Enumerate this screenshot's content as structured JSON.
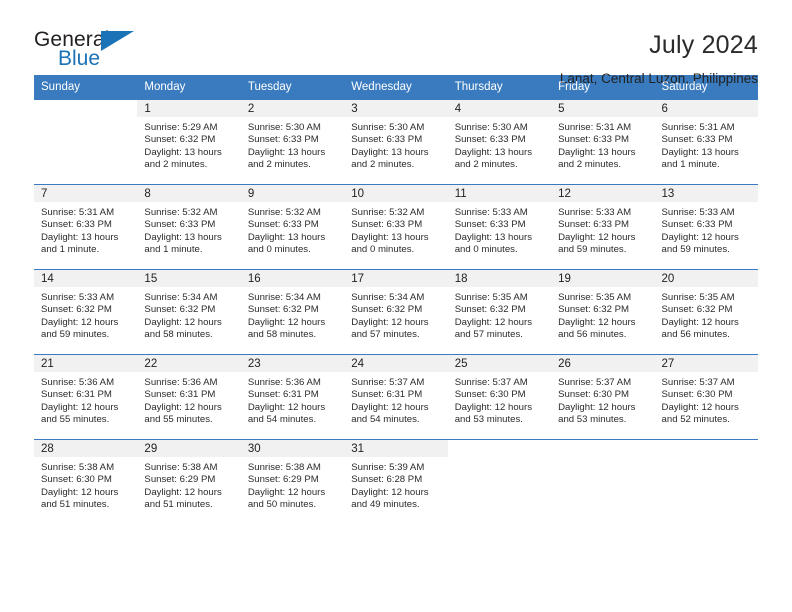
{
  "brand": {
    "word_one": "General",
    "word_two": "Blue",
    "triangle_icon": "blue-triangle-icon",
    "accent_color": "#1a73b7"
  },
  "header": {
    "month_title": "July 2024",
    "location": "Lanat, Central Luzon, Philippines"
  },
  "calendar": {
    "header_color": "#3a7bbf",
    "weekdays": [
      "Sunday",
      "Monday",
      "Tuesday",
      "Wednesday",
      "Thursday",
      "Friday",
      "Saturday"
    ],
    "weeks": [
      [
        {
          "day": "",
          "blank": true
        },
        {
          "day": "1",
          "sunrise": "Sunrise: 5:29 AM",
          "sunset": "Sunset: 6:32 PM",
          "daylight_1": "Daylight: 13 hours",
          "daylight_2": "and 2 minutes."
        },
        {
          "day": "2",
          "sunrise": "Sunrise: 5:30 AM",
          "sunset": "Sunset: 6:33 PM",
          "daylight_1": "Daylight: 13 hours",
          "daylight_2": "and 2 minutes."
        },
        {
          "day": "3",
          "sunrise": "Sunrise: 5:30 AM",
          "sunset": "Sunset: 6:33 PM",
          "daylight_1": "Daylight: 13 hours",
          "daylight_2": "and 2 minutes."
        },
        {
          "day": "4",
          "sunrise": "Sunrise: 5:30 AM",
          "sunset": "Sunset: 6:33 PM",
          "daylight_1": "Daylight: 13 hours",
          "daylight_2": "and 2 minutes."
        },
        {
          "day": "5",
          "sunrise": "Sunrise: 5:31 AM",
          "sunset": "Sunset: 6:33 PM",
          "daylight_1": "Daylight: 13 hours",
          "daylight_2": "and 2 minutes."
        },
        {
          "day": "6",
          "sunrise": "Sunrise: 5:31 AM",
          "sunset": "Sunset: 6:33 PM",
          "daylight_1": "Daylight: 13 hours",
          "daylight_2": "and 1 minute."
        }
      ],
      [
        {
          "day": "7",
          "sunrise": "Sunrise: 5:31 AM",
          "sunset": "Sunset: 6:33 PM",
          "daylight_1": "Daylight: 13 hours",
          "daylight_2": "and 1 minute."
        },
        {
          "day": "8",
          "sunrise": "Sunrise: 5:32 AM",
          "sunset": "Sunset: 6:33 PM",
          "daylight_1": "Daylight: 13 hours",
          "daylight_2": "and 1 minute."
        },
        {
          "day": "9",
          "sunrise": "Sunrise: 5:32 AM",
          "sunset": "Sunset: 6:33 PM",
          "daylight_1": "Daylight: 13 hours",
          "daylight_2": "and 0 minutes."
        },
        {
          "day": "10",
          "sunrise": "Sunrise: 5:32 AM",
          "sunset": "Sunset: 6:33 PM",
          "daylight_1": "Daylight: 13 hours",
          "daylight_2": "and 0 minutes."
        },
        {
          "day": "11",
          "sunrise": "Sunrise: 5:33 AM",
          "sunset": "Sunset: 6:33 PM",
          "daylight_1": "Daylight: 13 hours",
          "daylight_2": "and 0 minutes."
        },
        {
          "day": "12",
          "sunrise": "Sunrise: 5:33 AM",
          "sunset": "Sunset: 6:33 PM",
          "daylight_1": "Daylight: 12 hours",
          "daylight_2": "and 59 minutes."
        },
        {
          "day": "13",
          "sunrise": "Sunrise: 5:33 AM",
          "sunset": "Sunset: 6:33 PM",
          "daylight_1": "Daylight: 12 hours",
          "daylight_2": "and 59 minutes."
        }
      ],
      [
        {
          "day": "14",
          "sunrise": "Sunrise: 5:33 AM",
          "sunset": "Sunset: 6:32 PM",
          "daylight_1": "Daylight: 12 hours",
          "daylight_2": "and 59 minutes."
        },
        {
          "day": "15",
          "sunrise": "Sunrise: 5:34 AM",
          "sunset": "Sunset: 6:32 PM",
          "daylight_1": "Daylight: 12 hours",
          "daylight_2": "and 58 minutes."
        },
        {
          "day": "16",
          "sunrise": "Sunrise: 5:34 AM",
          "sunset": "Sunset: 6:32 PM",
          "daylight_1": "Daylight: 12 hours",
          "daylight_2": "and 58 minutes."
        },
        {
          "day": "17",
          "sunrise": "Sunrise: 5:34 AM",
          "sunset": "Sunset: 6:32 PM",
          "daylight_1": "Daylight: 12 hours",
          "daylight_2": "and 57 minutes."
        },
        {
          "day": "18",
          "sunrise": "Sunrise: 5:35 AM",
          "sunset": "Sunset: 6:32 PM",
          "daylight_1": "Daylight: 12 hours",
          "daylight_2": "and 57 minutes."
        },
        {
          "day": "19",
          "sunrise": "Sunrise: 5:35 AM",
          "sunset": "Sunset: 6:32 PM",
          "daylight_1": "Daylight: 12 hours",
          "daylight_2": "and 56 minutes."
        },
        {
          "day": "20",
          "sunrise": "Sunrise: 5:35 AM",
          "sunset": "Sunset: 6:32 PM",
          "daylight_1": "Daylight: 12 hours",
          "daylight_2": "and 56 minutes."
        }
      ],
      [
        {
          "day": "21",
          "sunrise": "Sunrise: 5:36 AM",
          "sunset": "Sunset: 6:31 PM",
          "daylight_1": "Daylight: 12 hours",
          "daylight_2": "and 55 minutes."
        },
        {
          "day": "22",
          "sunrise": "Sunrise: 5:36 AM",
          "sunset": "Sunset: 6:31 PM",
          "daylight_1": "Daylight: 12 hours",
          "daylight_2": "and 55 minutes."
        },
        {
          "day": "23",
          "sunrise": "Sunrise: 5:36 AM",
          "sunset": "Sunset: 6:31 PM",
          "daylight_1": "Daylight: 12 hours",
          "daylight_2": "and 54 minutes."
        },
        {
          "day": "24",
          "sunrise": "Sunrise: 5:37 AM",
          "sunset": "Sunset: 6:31 PM",
          "daylight_1": "Daylight: 12 hours",
          "daylight_2": "and 54 minutes."
        },
        {
          "day": "25",
          "sunrise": "Sunrise: 5:37 AM",
          "sunset": "Sunset: 6:30 PM",
          "daylight_1": "Daylight: 12 hours",
          "daylight_2": "and 53 minutes."
        },
        {
          "day": "26",
          "sunrise": "Sunrise: 5:37 AM",
          "sunset": "Sunset: 6:30 PM",
          "daylight_1": "Daylight: 12 hours",
          "daylight_2": "and 53 minutes."
        },
        {
          "day": "27",
          "sunrise": "Sunrise: 5:37 AM",
          "sunset": "Sunset: 6:30 PM",
          "daylight_1": "Daylight: 12 hours",
          "daylight_2": "and 52 minutes."
        }
      ],
      [
        {
          "day": "28",
          "sunrise": "Sunrise: 5:38 AM",
          "sunset": "Sunset: 6:30 PM",
          "daylight_1": "Daylight: 12 hours",
          "daylight_2": "and 51 minutes."
        },
        {
          "day": "29",
          "sunrise": "Sunrise: 5:38 AM",
          "sunset": "Sunset: 6:29 PM",
          "daylight_1": "Daylight: 12 hours",
          "daylight_2": "and 51 minutes."
        },
        {
          "day": "30",
          "sunrise": "Sunrise: 5:38 AM",
          "sunset": "Sunset: 6:29 PM",
          "daylight_1": "Daylight: 12 hours",
          "daylight_2": "and 50 minutes."
        },
        {
          "day": "31",
          "sunrise": "Sunrise: 5:39 AM",
          "sunset": "Sunset: 6:28 PM",
          "daylight_1": "Daylight: 12 hours",
          "daylight_2": "and 49 minutes."
        },
        {
          "day": "",
          "blank": true
        },
        {
          "day": "",
          "blank": true
        },
        {
          "day": "",
          "blank": true
        }
      ]
    ]
  }
}
